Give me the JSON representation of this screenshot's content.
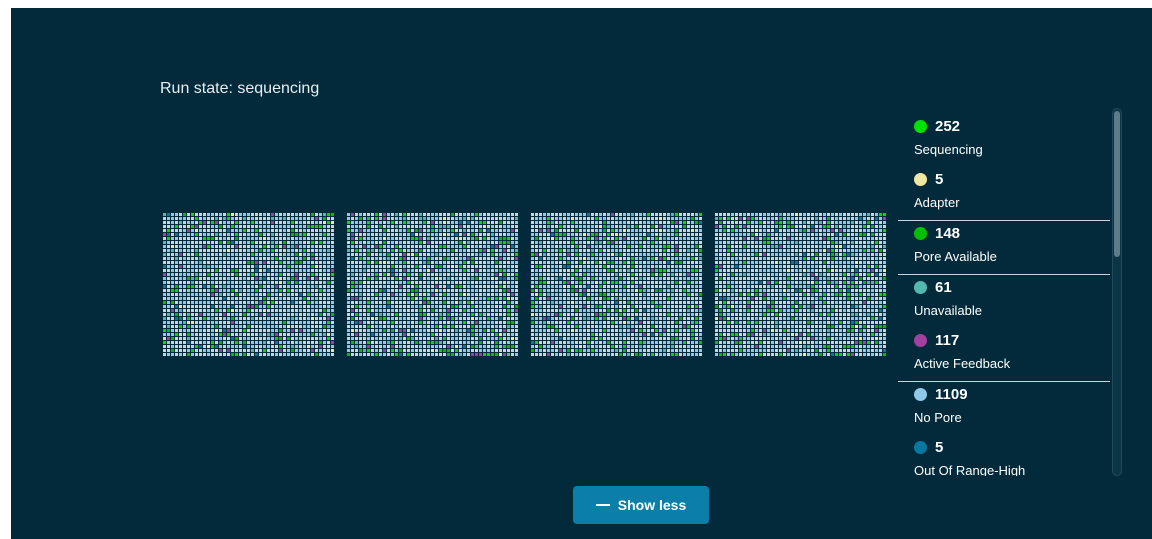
{
  "run_state": "Run state: sequencing",
  "legend": [
    {
      "count": "252",
      "label": "Sequencing",
      "color": "#00e000"
    },
    {
      "count": "5",
      "label": "Adapter",
      "color": "#eee8a0"
    },
    {
      "count": "148",
      "label": "Pore Available",
      "color": "#00c000"
    },
    {
      "count": "61",
      "label": "Unavailable",
      "color": "#55b8b0"
    },
    {
      "count": "117",
      "label": "Active Feedback",
      "color": "#a040a0"
    },
    {
      "count": "1109",
      "label": "No Pore",
      "color": "#90c8e8"
    },
    {
      "count": "5",
      "label": "Out Of Range-High",
      "color": "#0878a0"
    }
  ],
  "button": {
    "label": "Show less",
    "icon": "minus-icon"
  },
  "grid_count": 4
}
